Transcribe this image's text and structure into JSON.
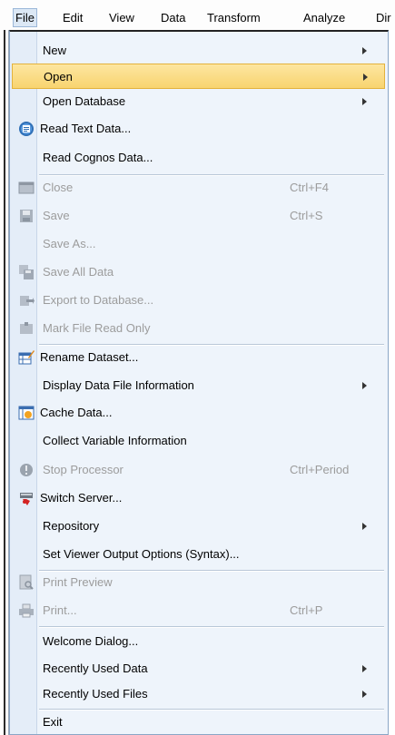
{
  "menubar": {
    "items": [
      {
        "label": "File",
        "active": true
      },
      {
        "label": "Edit"
      },
      {
        "label": "View"
      },
      {
        "label": "Data"
      },
      {
        "label": "Transform"
      },
      {
        "label": "Analyze"
      },
      {
        "label": "Dir"
      }
    ]
  },
  "file_menu": {
    "items": [
      {
        "label": "New",
        "submenu": true
      },
      {
        "label": "Open",
        "submenu": true,
        "highlighted": true
      },
      {
        "label": "Open Database",
        "submenu": true
      },
      {
        "label": "Read Text Data...",
        "icon": "read-text-data-icon"
      },
      {
        "label": "Read Cognos Data..."
      },
      {
        "label": "Close",
        "shortcut": "Ctrl+F4",
        "disabled": true,
        "icon": "close-icon"
      },
      {
        "label": "Save",
        "shortcut": "Ctrl+S",
        "disabled": true,
        "icon": "save-icon"
      },
      {
        "label": "Save As...",
        "disabled": true
      },
      {
        "label": "Save All Data",
        "disabled": true,
        "icon": "save-all-icon"
      },
      {
        "label": "Export to Database...",
        "disabled": true,
        "icon": "export-database-icon"
      },
      {
        "label": "Mark File Read Only",
        "disabled": true,
        "icon": "read-only-icon"
      },
      {
        "label": "Rename Dataset...",
        "icon": "rename-dataset-icon"
      },
      {
        "label": "Display Data File Information",
        "submenu": true
      },
      {
        "label": "Cache Data...",
        "icon": "cache-data-icon"
      },
      {
        "label": "Collect Variable Information"
      },
      {
        "label": "Stop Processor",
        "shortcut": "Ctrl+Period",
        "disabled": true,
        "icon": "stop-processor-icon"
      },
      {
        "label": "Switch Server...",
        "icon": "switch-server-icon"
      },
      {
        "label": "Repository",
        "submenu": true
      },
      {
        "label": "Set Viewer Output Options (Syntax)..."
      },
      {
        "label": "Print Preview",
        "disabled": true,
        "icon": "print-preview-icon"
      },
      {
        "label": "Print...",
        "shortcut": "Ctrl+P",
        "disabled": true,
        "icon": "print-icon"
      },
      {
        "label": "Welcome Dialog..."
      },
      {
        "label": "Recently Used Data",
        "submenu": true
      },
      {
        "label": "Recently Used Files",
        "submenu": true
      },
      {
        "label": "Exit"
      }
    ]
  }
}
